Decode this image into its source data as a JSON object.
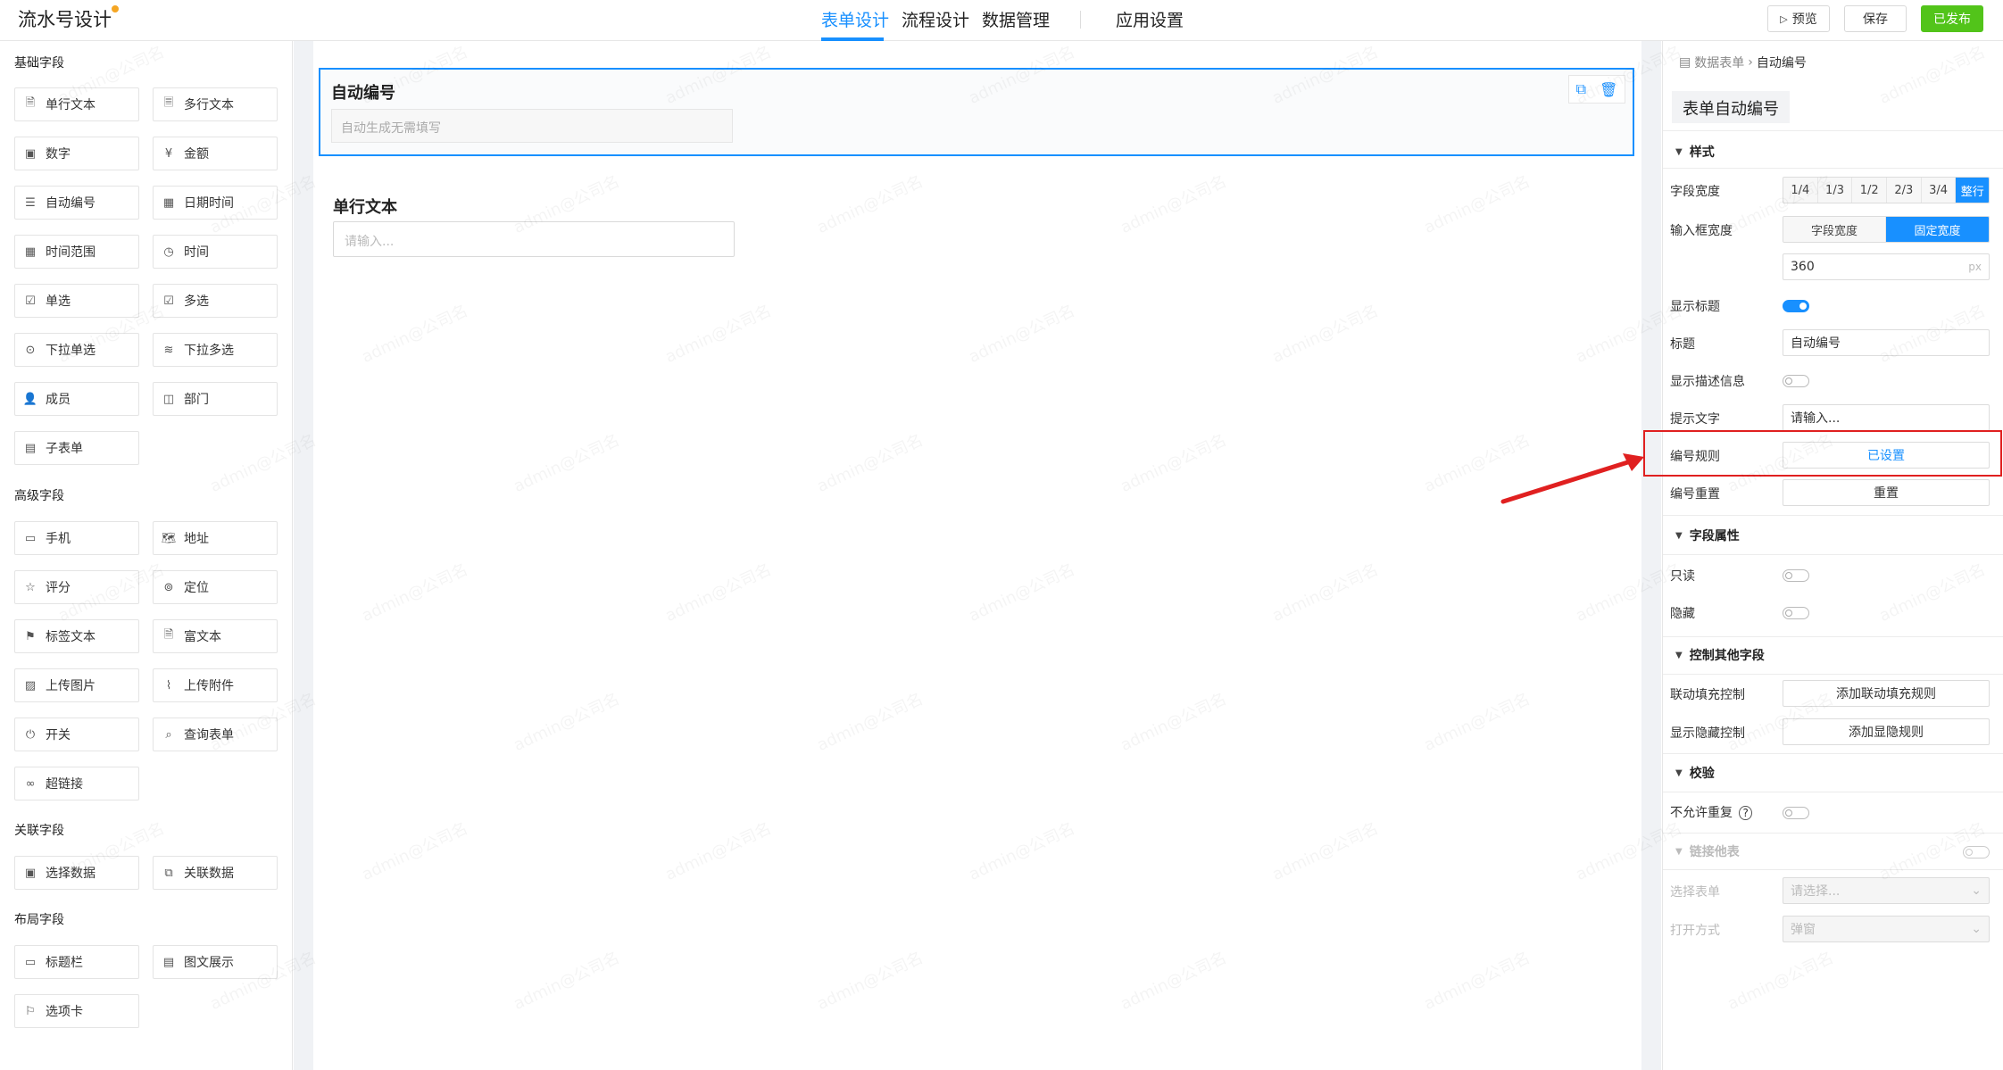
{
  "header": {
    "app_title": "流水号设计",
    "tabs": [
      {
        "label": "表单设计",
        "active": true
      },
      {
        "label": "流程设计",
        "active": false
      },
      {
        "label": "数据管理",
        "active": false
      },
      {
        "label": "应用设置",
        "active": false
      }
    ],
    "preview_label": "预览",
    "save_label": "保存",
    "publish_label": "已发布"
  },
  "left_panel": {
    "groups": [
      {
        "title": "基础字段",
        "items": [
          {
            "label": "单行文本",
            "icon": "single-line-icon"
          },
          {
            "label": "多行文本",
            "icon": "multi-line-icon"
          },
          {
            "label": "数字",
            "icon": "number-icon"
          },
          {
            "label": "金额",
            "icon": "amount-icon"
          },
          {
            "label": "自动编号",
            "icon": "auto-number-icon"
          },
          {
            "label": "日期时间",
            "icon": "datetime-icon"
          },
          {
            "label": "时间范围",
            "icon": "time-range-icon"
          },
          {
            "label": "时间",
            "icon": "clock-icon"
          },
          {
            "label": "单选",
            "icon": "radio-icon"
          },
          {
            "label": "多选",
            "icon": "checkbox-icon"
          },
          {
            "label": "下拉单选",
            "icon": "dropdown-single-icon"
          },
          {
            "label": "下拉多选",
            "icon": "dropdown-multi-icon"
          },
          {
            "label": "成员",
            "icon": "member-icon"
          },
          {
            "label": "部门",
            "icon": "department-icon"
          },
          {
            "label": "子表单",
            "icon": "subform-icon"
          }
        ]
      },
      {
        "title": "高级字段",
        "items": [
          {
            "label": "手机",
            "icon": "phone-icon"
          },
          {
            "label": "地址",
            "icon": "address-icon"
          },
          {
            "label": "评分",
            "icon": "star-icon"
          },
          {
            "label": "定位",
            "icon": "location-icon"
          },
          {
            "label": "标签文本",
            "icon": "tag-icon"
          },
          {
            "label": "富文本",
            "icon": "rich-text-icon"
          },
          {
            "label": "上传图片",
            "icon": "image-icon"
          },
          {
            "label": "上传附件",
            "icon": "attachment-icon"
          },
          {
            "label": "开关",
            "icon": "power-icon"
          },
          {
            "label": "查询表单",
            "icon": "query-icon"
          },
          {
            "label": "超链接",
            "icon": "link-icon"
          }
        ]
      },
      {
        "title": "关联字段",
        "items": [
          {
            "label": "选择数据",
            "icon": "select-data-icon"
          },
          {
            "label": "关联数据",
            "icon": "relate-data-icon"
          }
        ]
      },
      {
        "title": "布局字段",
        "items": [
          {
            "label": "标题栏",
            "icon": "title-bar-icon"
          },
          {
            "label": "图文展示",
            "icon": "image-text-icon"
          },
          {
            "label": "选项卡",
            "icon": "tab-card-icon"
          }
        ]
      }
    ]
  },
  "canvas": {
    "selected_field": {
      "label": "自动编号",
      "placeholder": "自动生成无需填写"
    },
    "field2": {
      "label": "单行文本",
      "placeholder": "请输入..."
    }
  },
  "right_panel": {
    "breadcrumb": [
      "数据表单",
      "自动编号"
    ],
    "title": "表单自动编号",
    "sections": {
      "style": "样式",
      "field_props": "字段属性",
      "control": "控制其他字段",
      "validate": "校验",
      "link": "链接他表"
    },
    "props": {
      "field_width_label": "字段宽度",
      "field_width_options": [
        "1/4",
        "1/3",
        "1/2",
        "2/3",
        "3/4",
        "整行"
      ],
      "field_width_selected": "整行",
      "input_width_label": "输入框宽度",
      "input_width_options": [
        "字段宽度",
        "固定宽度"
      ],
      "input_width_selected": "固定宽度",
      "width_value": "360",
      "width_unit": "px",
      "show_title_label": "显示标题",
      "show_title_on": true,
      "title_label": "标题",
      "title_value": "自动编号",
      "show_desc_label": "显示描述信息",
      "hint_label": "提示文字",
      "hint_value": "请输入...",
      "rule_label": "编号规则",
      "rule_value": "已设置",
      "reset_label": "编号重置",
      "reset_value": "重置",
      "readonly_label": "只读",
      "hidden_label": "隐藏",
      "linkage_label": "联动填充控制",
      "linkage_value": "添加联动填充规则",
      "visibility_label": "显示隐藏控制",
      "visibility_value": "添加显隐规则",
      "no_repeat_label": "不允许重复",
      "select_form_label": "选择表单",
      "select_form_placeholder": "请选择...",
      "open_mode_label": "打开方式",
      "open_mode_value": "弹窗"
    }
  },
  "watermark": "admin@公司名",
  "colors": {
    "accent": "#1890ff",
    "publish": "#52c41a",
    "annotation": "#e02020"
  }
}
